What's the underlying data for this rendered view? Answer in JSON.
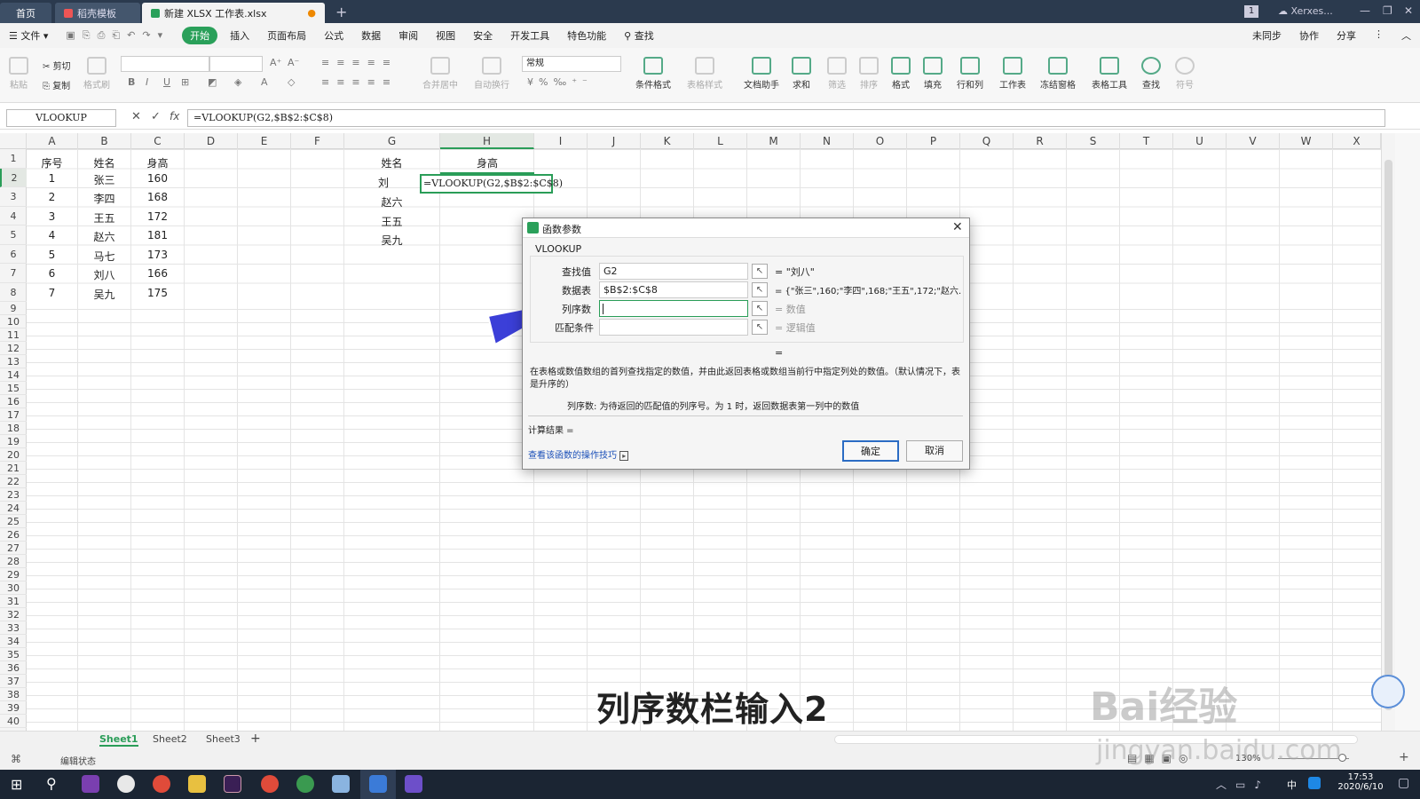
{
  "titlebar": {
    "tabs": [
      {
        "label": "首页"
      },
      {
        "label": "稻壳模板"
      },
      {
        "label": "新建 XLSX 工作表.xlsx"
      }
    ],
    "user": "Xerxes...",
    "badge": "1",
    "new_tab": "+"
  },
  "menubar": {
    "file": "文件",
    "items": [
      "开始",
      "插入",
      "页面布局",
      "公式",
      "数据",
      "审阅",
      "视图",
      "安全",
      "开发工具",
      "特色功能"
    ],
    "search": "查找",
    "right": [
      "未同步",
      "协作",
      "分享"
    ]
  },
  "ribbon": {
    "paste": "粘贴",
    "cut": "剪切",
    "copy": "复制",
    "format_painter": "格式刷",
    "merge": "合并居中",
    "wrap": "自动换行",
    "number_format": "常规",
    "cond_format": "条件格式",
    "table_style": "表格样式",
    "doc_helper": "文档助手",
    "sum": "求和",
    "filter": "筛选",
    "sort": "排序",
    "format": "格式",
    "fill": "填充",
    "rowcol": "行和列",
    "worksheet": "工作表",
    "freeze": "冻结窗格",
    "table_tools": "表格工具",
    "find": "查找",
    "symbol": "符号"
  },
  "formula_bar": {
    "name_box": "VLOOKUP",
    "fx": "fx",
    "formula": "=VLOOKUP(G2,$B$2:$C$8)"
  },
  "columns": [
    "A",
    "B",
    "C",
    "D",
    "E",
    "F",
    "G",
    "H",
    "I",
    "J",
    "K",
    "L",
    "M",
    "N",
    "O",
    "P",
    "Q",
    "R",
    "S",
    "T",
    "U",
    "V",
    "W",
    "X"
  ],
  "rows": [
    "1",
    "2",
    "3",
    "4",
    "5",
    "6",
    "7",
    "8",
    "9",
    "10",
    "11",
    "12",
    "13",
    "14",
    "15",
    "16",
    "17",
    "18",
    "19",
    "20",
    "21",
    "22",
    "23",
    "24",
    "25",
    "26",
    "27",
    "28",
    "29",
    "30",
    "31",
    "32",
    "33",
    "34",
    "35",
    "36",
    "37",
    "38",
    "39",
    "40"
  ],
  "table": {
    "headers": [
      "序号",
      "姓名",
      "身高"
    ],
    "rows": [
      [
        "1",
        "张三",
        "160"
      ],
      [
        "2",
        "李四",
        "168"
      ],
      [
        "3",
        "王五",
        "172"
      ],
      [
        "4",
        "赵六",
        "181"
      ],
      [
        "5",
        "马七",
        "173"
      ],
      [
        "6",
        "刘八",
        "166"
      ],
      [
        "7",
        "吴九",
        "175"
      ]
    ]
  },
  "lookup": {
    "header_g": "姓名",
    "header_h": "身高",
    "g_values": [
      "刘",
      "赵六",
      "王五",
      "吴九"
    ],
    "h2_formula": "=VLOOKUP(G2,$B$2:$C$8)"
  },
  "dialog": {
    "title": "函数参数",
    "func": "VLOOKUP",
    "args": [
      {
        "label": "查找值",
        "value": "G2",
        "result": "= \"刘八\""
      },
      {
        "label": "数据表",
        "value": "$B$2:$C$8",
        "result": "= {\"张三\",160;\"李四\",168;\"王五\",172;\"赵六..."
      },
      {
        "label": "列序数",
        "value": "",
        "result": "= 数值"
      },
      {
        "label": "匹配条件",
        "value": "",
        "result": "= 逻辑值"
      }
    ],
    "eq": "=",
    "description": "在表格或数值数组的首列查找指定的数值，并由此返回表格或数组当前行中指定列处的数值。（默认情况下，表是升序的）",
    "arg_help": "列序数:   为待返回的匹配值的列序号。为 1 时，返回数据表第一列中的数值",
    "calc_result": "计算结果 =",
    "link": "查看该函数的操作技巧",
    "ok": "确定",
    "cancel": "取消"
  },
  "sheets": [
    "Sheet1",
    "Sheet2",
    "Sheet3"
  ],
  "add_sheet": "+",
  "status": {
    "mode": "编辑状态",
    "zoom": "130%"
  },
  "subtitle": "列序数栏输入2",
  "watermark": {
    "brand": "Bai经验",
    "url": "jingyan.baidu.com"
  },
  "taskbar": {
    "time": "17:53",
    "date": "2020/6/10",
    "ime": "中"
  },
  "colors": {
    "accent": "#2aa05a",
    "titlebar": "#2b3a4e",
    "arrow": "#3b3fd8",
    "taskbar": "#1b2533"
  }
}
